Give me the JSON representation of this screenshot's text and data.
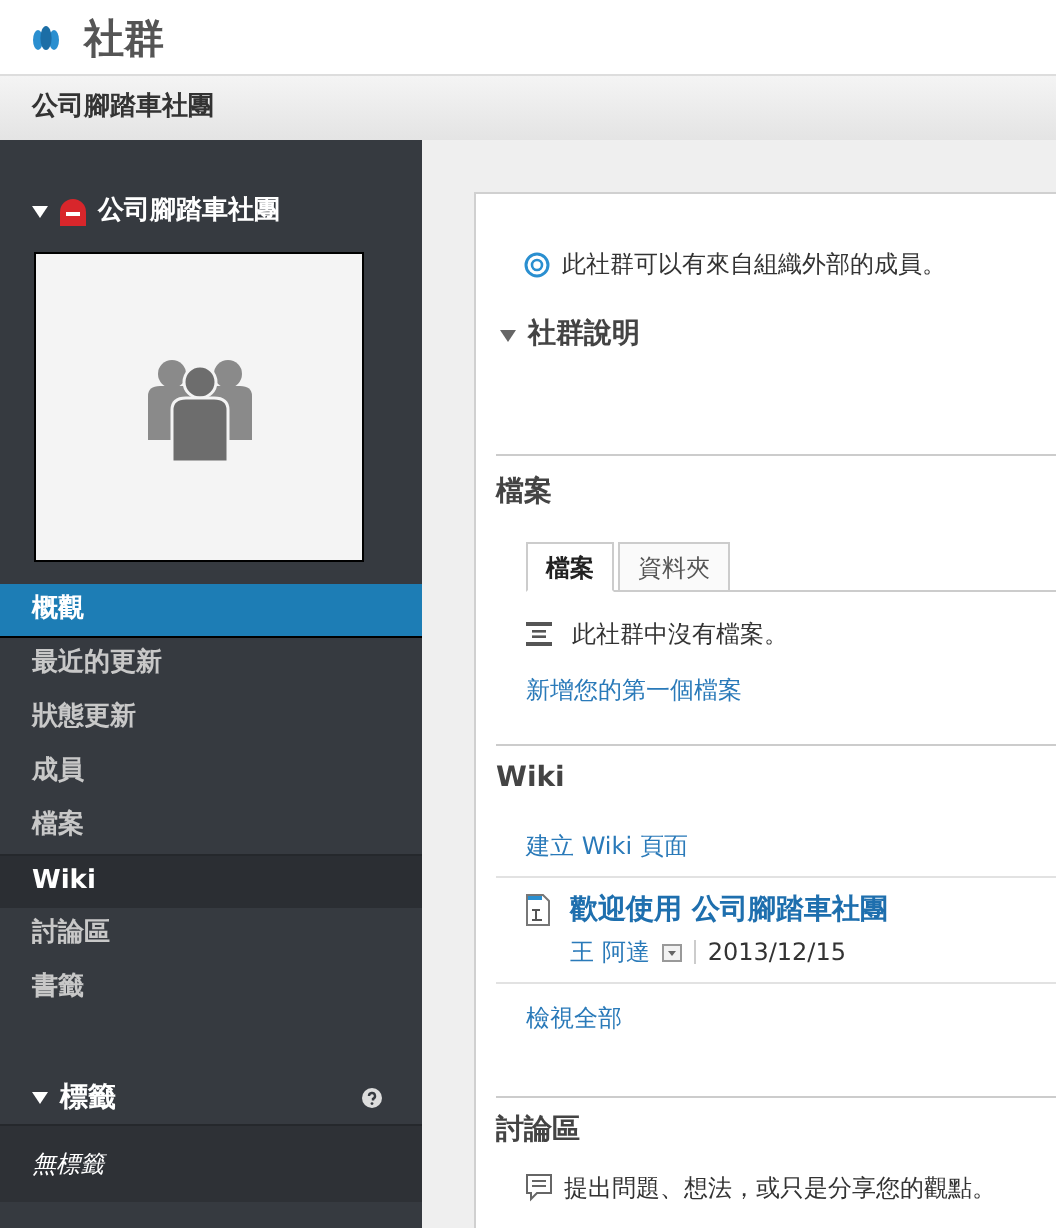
{
  "header": {
    "title": "社群"
  },
  "breadcrumb": {
    "title": "公司腳踏車社團"
  },
  "sidebar": {
    "community": {
      "name": "公司腳踏車社團",
      "expanded": true
    },
    "nav": [
      {
        "label": "概觀",
        "selected": true,
        "hovered": false
      },
      {
        "label": "最近的更新",
        "selected": false,
        "hovered": false
      },
      {
        "label": "狀態更新",
        "selected": false,
        "hovered": false
      },
      {
        "label": "成員",
        "selected": false,
        "hovered": false
      },
      {
        "label": "檔案",
        "selected": false,
        "hovered": false
      },
      {
        "label": "Wiki",
        "selected": false,
        "hovered": true
      },
      {
        "label": "討論區",
        "selected": false,
        "hovered": false
      },
      {
        "label": "書籤",
        "selected": false,
        "hovered": false
      }
    ],
    "tags": {
      "title": "標籤",
      "expanded": true,
      "empty_text": "無標籤"
    }
  },
  "main": {
    "notice": "此社群可以有來自組織外部的成員。",
    "description": {
      "title": "社群說明",
      "expanded": true
    },
    "files": {
      "title": "檔案",
      "tabs": [
        {
          "label": "檔案",
          "selected": true
        },
        {
          "label": "資料夾",
          "selected": false
        }
      ],
      "empty_text": "此社群中沒有檔案。",
      "add_link": "新增您的第一個檔案"
    },
    "wiki": {
      "title": "Wiki",
      "create_link": "建立 Wiki 頁面",
      "pages": [
        {
          "title": "歡迎使用 公司腳踏車社團",
          "author": "王 阿達",
          "date": "2013/12/15"
        }
      ],
      "view_all": "檢視全部"
    },
    "forum": {
      "title": "討論區",
      "prompt": "提出問題、想法，或只是分享您的觀點。"
    }
  }
}
